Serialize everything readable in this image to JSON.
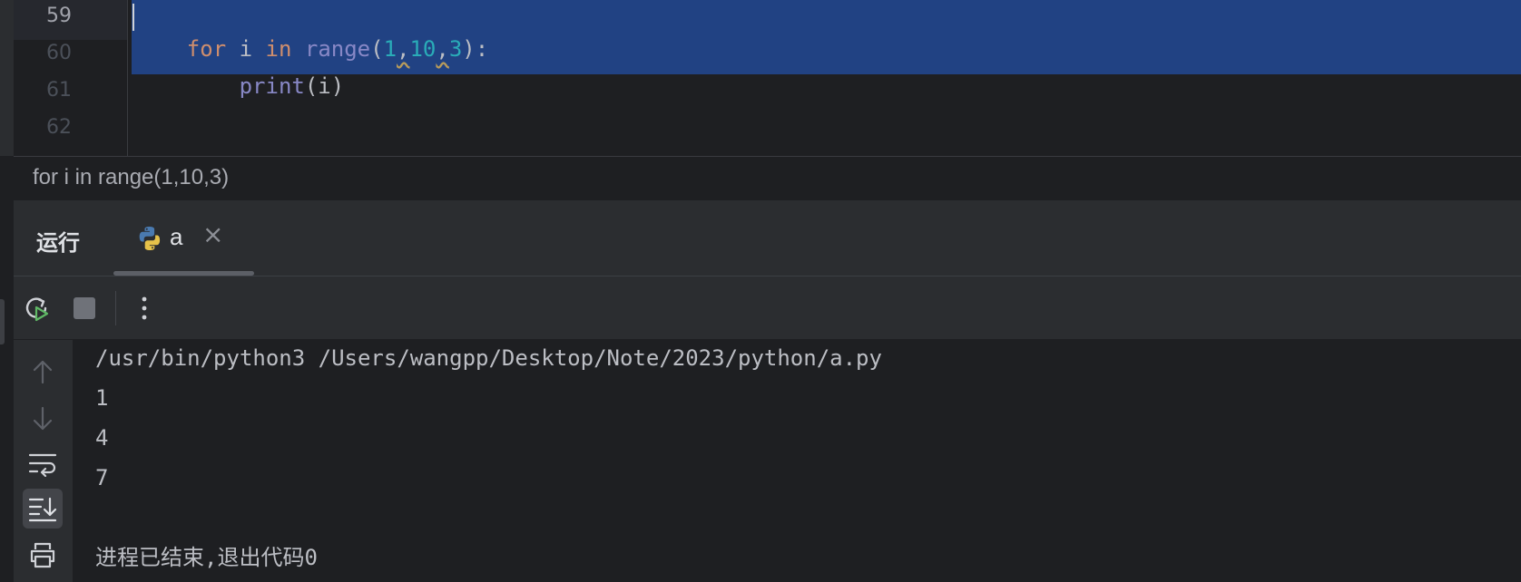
{
  "editor": {
    "line_numbers": [
      "59",
      "60",
      "61",
      "62"
    ],
    "current_line": "59",
    "code_lines": [
      {
        "tokens": [
          {
            "text": "for",
            "type": "keyword"
          },
          {
            "text": " i ",
            "type": "plain"
          },
          {
            "text": "in",
            "type": "keyword"
          },
          {
            "text": " ",
            "type": "plain"
          },
          {
            "text": "range",
            "type": "builtin"
          },
          {
            "text": "(",
            "type": "plain"
          },
          {
            "text": "1",
            "type": "number"
          },
          {
            "text": ",",
            "type": "plain"
          },
          {
            "text": "10",
            "type": "number"
          },
          {
            "text": ",",
            "type": "plain"
          },
          {
            "text": "3",
            "type": "number"
          },
          {
            "text": "):",
            "type": "plain"
          }
        ]
      },
      {
        "tokens": [
          {
            "text": "    ",
            "type": "plain"
          },
          {
            "text": "print",
            "type": "builtin"
          },
          {
            "text": "(i)",
            "type": "plain"
          }
        ]
      }
    ]
  },
  "breadcrumb": {
    "text": "for i in range(1,10,3)"
  },
  "run": {
    "title": "运行",
    "tab_label": "a",
    "tab_icon": "python-icon",
    "toolbar": {
      "rerun_icon": "rerun-icon",
      "stop_icon": "stop-icon",
      "more_icon": "more-vertical-icon"
    },
    "side_tools": [
      "arrow-up-icon",
      "arrow-down-icon",
      "soft-wrap-icon",
      "scroll-to-end-icon",
      "print-icon"
    ],
    "console_lines": [
      "/usr/bin/python3 /Users/wangpp/Desktop/Note/2023/python/a.py",
      "1",
      "4",
      "7",
      "",
      "进程已结束,退出代码0"
    ]
  },
  "colors": {
    "editor_bg": "#1e1f22",
    "panel_bg": "#2b2d30",
    "selection": "#214283",
    "keyword": "#cf8e6d",
    "builtin": "#8888c6",
    "number": "#2aacb8",
    "text": "#bcbec4"
  }
}
